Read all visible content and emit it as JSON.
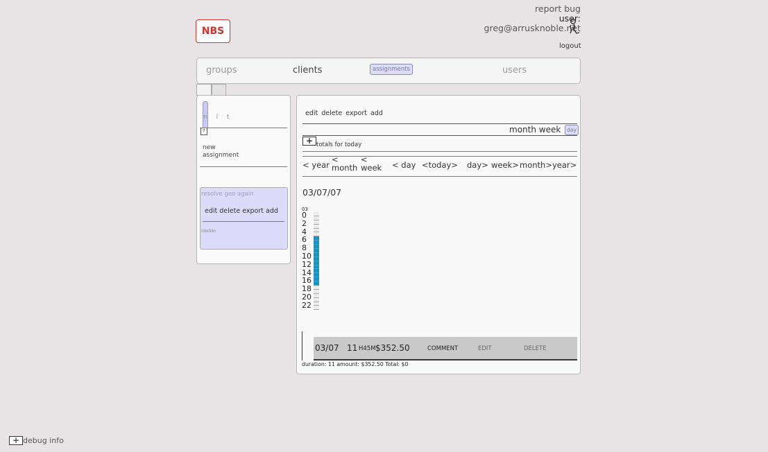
{
  "header": {
    "logo_text": "NBS",
    "report_bug": "report bug",
    "user_label": "user:",
    "email": "greg@arrusknoble.net",
    "logout": "logout"
  },
  "nav": {
    "groups": "groups",
    "clients": "clients",
    "assignments": "assignments",
    "users": "users"
  },
  "left": {
    "nit_label": "n i t",
    "help_icon": "?",
    "new_assignment": "new\nassignment",
    "resolve": "resolve geo again",
    "actions": "edit delete export add",
    "clockin": "clockin"
  },
  "main": {
    "actions": "edit  delete export add",
    "views": "month week",
    "day_button": "day",
    "plus": "+",
    "totals": "totals for today",
    "nav": {
      "prev_year": "< year",
      "prev_month_arrow": "<",
      "prev_month": "month",
      "prev_week_arrow": "<",
      "prev_week": "week",
      "prev_day": "< day",
      "today": "<today>",
      "next_day": "day>",
      "next_week": "week>",
      "next_month": "month>",
      "next_year": "year>"
    },
    "date": "03/07/07",
    "hour_top": "03",
    "hours": [
      "0",
      "2",
      "4",
      "6",
      "8",
      "10",
      "12",
      "14",
      "16",
      "18",
      "20",
      "22"
    ],
    "active_hour_start": 6,
    "active_hour_end": 17,
    "entry": {
      "date": "03/07",
      "duration": "11",
      "hm": "H45M",
      "amount": "$352.50",
      "comment": "COMMENT",
      "edit": "EDIT",
      "delete": "DELETE"
    },
    "summary": "duration: 11 amount: $352.50 Total: $0"
  },
  "footer": {
    "plus": "+",
    "debug": "debug info"
  },
  "colors": {
    "brand": "#d0342c",
    "accent_purple": "#dcdcf4",
    "active_blue": "#1c93c6"
  }
}
